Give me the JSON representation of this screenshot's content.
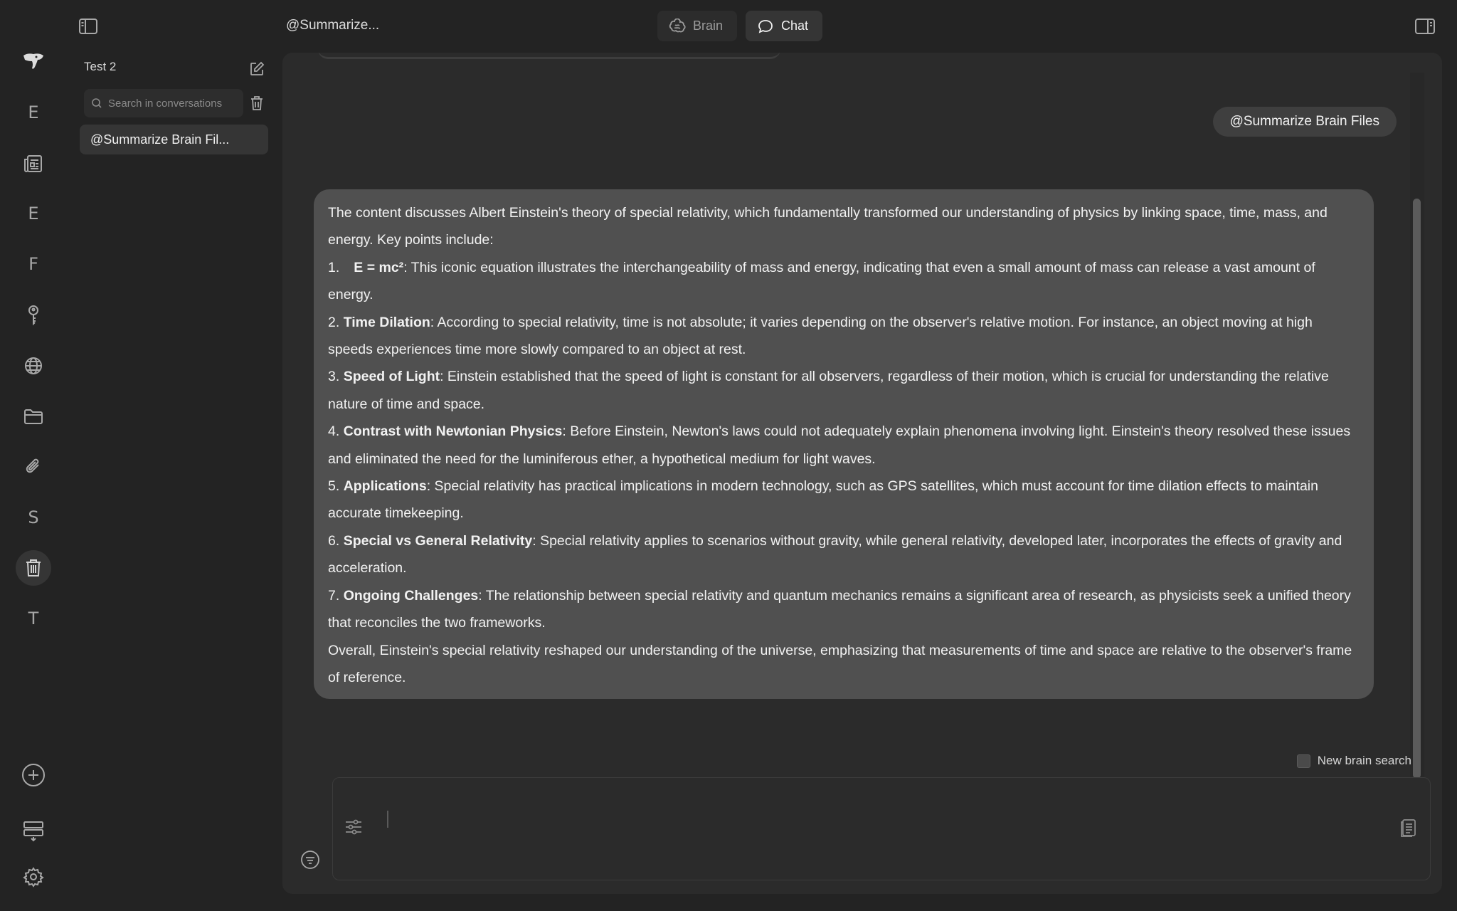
{
  "topbar": {
    "conversation_title": "@Summarize...",
    "tabs": [
      {
        "label": "Brain",
        "icon": "brain-icon",
        "active": false
      },
      {
        "label": "Chat",
        "icon": "chat-bubble-icon",
        "active": true
      }
    ]
  },
  "rail": {
    "items": [
      {
        "name": "logo",
        "icon": "elephant-logo-icon"
      },
      {
        "name": "E",
        "letter": "E"
      },
      {
        "name": "news",
        "icon": "newspaper-icon"
      },
      {
        "name": "E2",
        "letter": "E"
      },
      {
        "name": "F",
        "letter": "F"
      },
      {
        "name": "key",
        "icon": "key-icon"
      },
      {
        "name": "globe",
        "icon": "globe-icon"
      },
      {
        "name": "folder",
        "icon": "folder-icon"
      },
      {
        "name": "attach",
        "icon": "paperclip-icon"
      },
      {
        "name": "S",
        "letter": "S"
      },
      {
        "name": "trash",
        "icon": "trash-icon",
        "active": true
      },
      {
        "name": "T",
        "letter": "T"
      },
      {
        "name": "add",
        "icon": "plus-circle-icon"
      },
      {
        "name": "layout",
        "icon": "layout-icon"
      },
      {
        "name": "settings",
        "icon": "gear-icon"
      }
    ]
  },
  "sidebar": {
    "title": "Test 2",
    "search_placeholder": "Search in conversations",
    "conversations": [
      {
        "label": "@Summarize Brain Fil..."
      }
    ]
  },
  "chat": {
    "user_message": "@Summarize Brain Files",
    "answer": {
      "intro": "The content discusses Albert Einstein's theory of special relativity, which fundamentally transformed our understanding of physics by linking space, time, mass, and energy. Key points include:",
      "points": [
        {
          "num": "1.",
          "term": "E = mc²",
          "text": ": This iconic equation illustrates the interchangeability of mass and energy, indicating that even a small amount of mass can release a vast amount of energy."
        },
        {
          "num": "2.",
          "term": "Time Dilation",
          "text": ": According to special relativity, time is not absolute; it varies depending on the observer's relative motion. For instance, an object moving at high speeds experiences time more slowly compared to an object at rest."
        },
        {
          "num": "3.",
          "term": "Speed of Light",
          "text": ": Einstein established that the speed of light is constant for all observers, regardless of their motion, which is crucial for understanding the relative nature of time and space."
        },
        {
          "num": "4.",
          "term": "Contrast with Newtonian Physics",
          "text": ": Before Einstein, Newton's laws could not adequately explain phenomena involving light. Einstein's theory resolved these issues and eliminated the need for the luminiferous ether, a hypothetical medium for light waves."
        },
        {
          "num": "5.",
          "term": "Applications",
          "text": ": Special relativity has practical implications in modern technology, such as GPS satellites, which must account for time dilation effects to maintain accurate timekeeping."
        },
        {
          "num": "6.",
          "term": "Special vs General Relativity",
          "text": ": Special relativity applies to scenarios without gravity, while general relativity, developed later, incorporates the effects of gravity and acceleration."
        },
        {
          "num": "7.",
          "term": "Ongoing Challenges",
          "text": ": The relationship between special relativity and quantum mechanics remains a significant area of research, as physicists seek a unified theory that reconciles the two frameworks."
        }
      ],
      "conclusion": "Overall, Einstein's special relativity reshaped our understanding of the universe, emphasizing that measurements of time and space are relative to the observer's frame of reference."
    },
    "new_brain_search_label": "New brain search",
    "new_brain_search_checked": false,
    "composer_value": ""
  }
}
